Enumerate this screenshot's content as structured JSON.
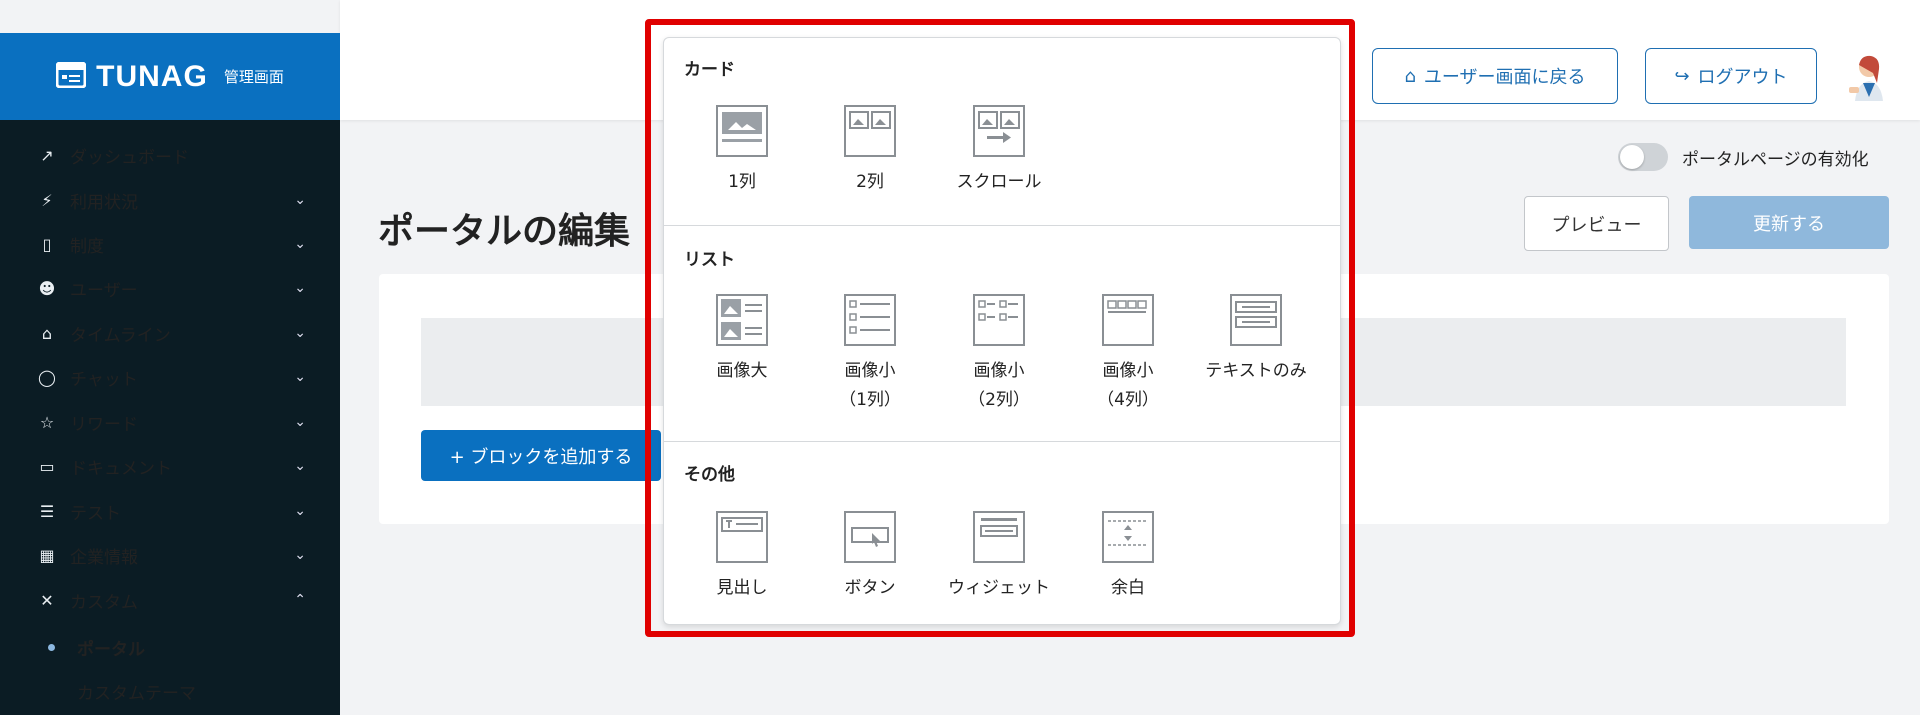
{
  "header": {
    "back_label": "ユーザー画面に戻る",
    "logout_label": "ログアウト"
  },
  "brand": {
    "logo": "TUNAG",
    "sub": "管理画面"
  },
  "sidebar": {
    "items": [
      {
        "label": "ダッシュボード",
        "icon": "chart-icon",
        "chevron": ""
      },
      {
        "label": "利用状況",
        "icon": "pulse-icon",
        "chevron": "⌄"
      },
      {
        "label": "制度",
        "icon": "book-icon",
        "chevron": "⌄"
      },
      {
        "label": "ユーザー",
        "icon": "users-icon",
        "chevron": "⌄"
      },
      {
        "label": "タイムライン",
        "icon": "home-icon",
        "chevron": "⌄"
      },
      {
        "label": "チャット",
        "icon": "chat-icon",
        "chevron": "⌄"
      },
      {
        "label": "リワード",
        "icon": "star-icon",
        "chevron": "⌄"
      },
      {
        "label": "ドキュメント",
        "icon": "folder-icon",
        "chevron": "⌄"
      },
      {
        "label": "テスト",
        "icon": "list-icon",
        "chevron": "⌄"
      },
      {
        "label": "企業情報",
        "icon": "building-icon",
        "chevron": "⌄"
      },
      {
        "label": "カスタム",
        "icon": "tools-icon",
        "chevron": "⌃"
      }
    ],
    "subitems": [
      {
        "label": "ポータル",
        "active": true
      },
      {
        "label": "カスタムテーマ",
        "active": false
      }
    ]
  },
  "main": {
    "toggle_label": "ポータルページの有効化",
    "toggle_on": false,
    "title": "ポータルの編集",
    "preview_label": "プレビュー",
    "update_label": "更新する",
    "add_block_label": "+ ブロックを追加する"
  },
  "popup": {
    "sections": [
      {
        "title": "カード",
        "options": [
          {
            "label": "1列",
            "sub": "",
            "icon": "card-1col-icon"
          },
          {
            "label": "2列",
            "sub": "",
            "icon": "card-2col-icon"
          },
          {
            "label": "スクロール",
            "sub": "",
            "icon": "card-scroll-icon"
          }
        ]
      },
      {
        "title": "リスト",
        "options": [
          {
            "label": "画像大",
            "sub": "",
            "icon": "list-image-large-icon"
          },
          {
            "label": "画像小",
            "sub": "（1列）",
            "icon": "list-image-small-1col-icon"
          },
          {
            "label": "画像小",
            "sub": "（2列）",
            "icon": "list-image-small-2col-icon"
          },
          {
            "label": "画像小",
            "sub": "（4列）",
            "icon": "list-image-small-4col-icon"
          },
          {
            "label": "テキストのみ",
            "sub": "",
            "icon": "list-text-only-icon"
          }
        ]
      },
      {
        "title": "その他",
        "options": [
          {
            "label": "見出し",
            "sub": "",
            "icon": "heading-icon"
          },
          {
            "label": "ボタン",
            "sub": "",
            "icon": "button-block-icon"
          },
          {
            "label": "ウィジェット",
            "sub": "",
            "icon": "widget-icon"
          },
          {
            "label": "余白",
            "sub": "",
            "icon": "spacer-icon"
          }
        ]
      }
    ]
  },
  "colors": {
    "brand": "#0a70c0",
    "sidebar": "#0b1c24",
    "highlight": "#e00000"
  }
}
